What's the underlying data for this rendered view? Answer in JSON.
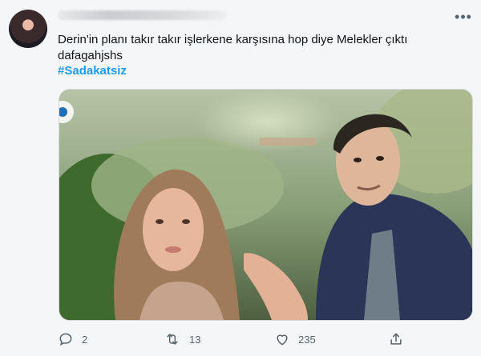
{
  "tweet": {
    "text_line1": "Derin'in planı takır takır işlerkene karşısına hop diye Melekler çıktı",
    "text_line2": "dafagahjshs",
    "hashtag": "#Sadakatsiz"
  },
  "icons": {
    "more": "more-icon",
    "reply": "reply-icon",
    "retweet": "retweet-icon",
    "like": "heart-icon",
    "share": "share-icon"
  },
  "actions": {
    "reply_count": "2",
    "retweet_count": "13",
    "like_count": "235"
  },
  "colors": {
    "accent": "#1d9bf0",
    "muted": "#536471"
  }
}
